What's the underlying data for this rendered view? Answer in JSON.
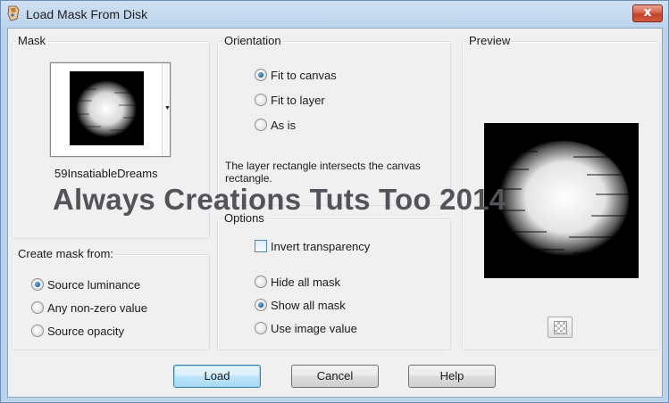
{
  "window": {
    "title": "Load Mask From Disk",
    "close_label": "x"
  },
  "mask_group": {
    "title": "Mask",
    "selected_mask": "59InsatiableDreams",
    "dropdown_glyph": "▼"
  },
  "orientation_group": {
    "title": "Orientation",
    "options": [
      {
        "label": "Fit to canvas",
        "checked": true
      },
      {
        "label": "Fit to layer",
        "checked": false
      },
      {
        "label": "As is",
        "checked": false
      }
    ],
    "info_text": "The layer rectangle intersects the canvas rectangle."
  },
  "preview_group": {
    "title": "Preview",
    "toggle_icon": "checkerboard-icon"
  },
  "create_mask_group": {
    "title": "Create mask from:",
    "options": [
      {
        "label": "Source luminance",
        "checked": true
      },
      {
        "label": "Any non-zero value",
        "checked": false
      },
      {
        "label": "Source opacity",
        "checked": false
      }
    ]
  },
  "options_group": {
    "title": "Options",
    "invert_transparency": {
      "label": "Invert transparency",
      "checked": false
    },
    "options": [
      {
        "label": "Hide all mask",
        "checked": false
      },
      {
        "label": "Show all mask",
        "checked": true
      },
      {
        "label": "Use image value",
        "checked": false
      }
    ]
  },
  "watermark": "Always Creations Tuts Too 2014",
  "buttons": {
    "load": "Load",
    "cancel": "Cancel",
    "help": "Help"
  },
  "colors": {
    "title_bar": "#bcd3ec",
    "client_bg": "#f0f0f0",
    "close_button": "#c2412a",
    "default_button": "#bee6fd",
    "watermark": "#55535a"
  }
}
